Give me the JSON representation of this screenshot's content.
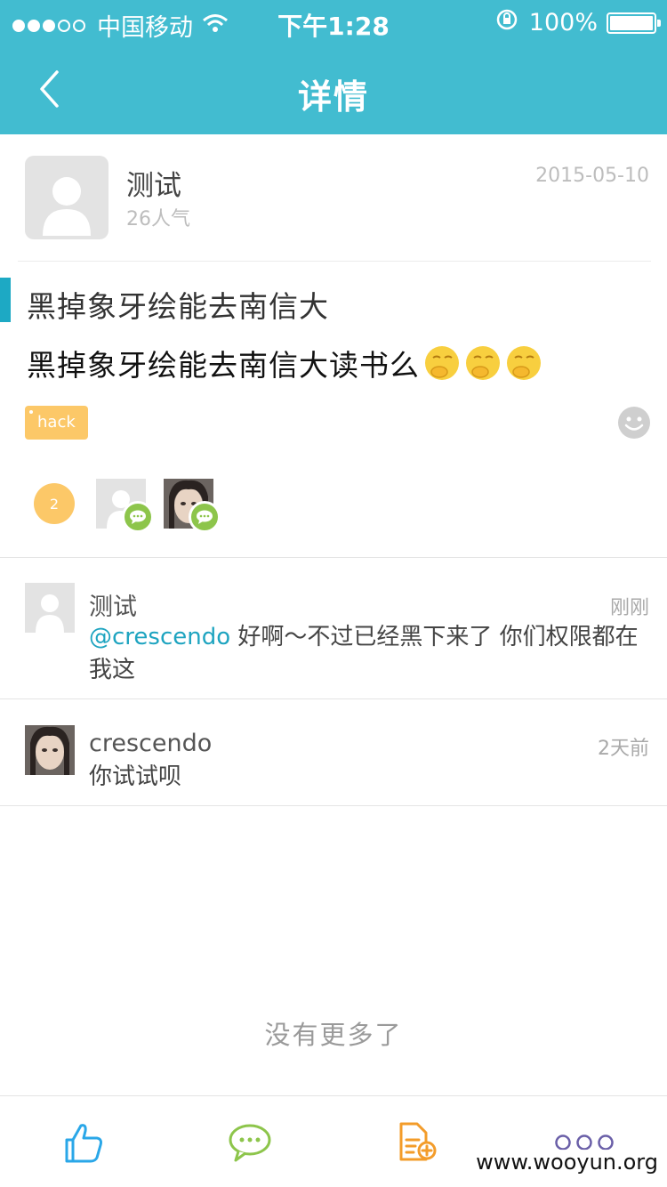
{
  "status_bar": {
    "carrier": "中国移动",
    "time": "下午1:28",
    "battery": "100%"
  },
  "nav": {
    "title": "详情"
  },
  "author": {
    "name": "测试",
    "popularity": "26人气",
    "date": "2015-05-10"
  },
  "post": {
    "title": "黑掉象牙绘能去南信大",
    "body": "黑掉象牙绘能去南信大读书么",
    "emoji_count": 3,
    "tag": "hack"
  },
  "participants": {
    "count": "2"
  },
  "comments": [
    {
      "name": "测试",
      "time": "刚刚",
      "mention": "@crescendo",
      "text": " 好啊～不过已经黑下来了 你们权限都在我这"
    },
    {
      "name": "crescendo",
      "time": "2天前",
      "mention": "",
      "text": "你试试呗"
    }
  ],
  "footer": {
    "no_more": "没有更多了"
  },
  "watermark": "www.wooyun.org",
  "colors": {
    "header": "#42bcd0",
    "accent": "#1da9c4",
    "tag": "#fcc868",
    "comment_badge": "#8dc54b",
    "like_icon": "#2aa7e8",
    "comment_icon": "#8dc54b",
    "add_doc_icon": "#f39c2a",
    "more_icon": "#6a5fa8"
  },
  "tabbar": {
    "icons": [
      "thumbs-up-icon",
      "comment-icon",
      "add-document-icon",
      "more-icon"
    ]
  }
}
